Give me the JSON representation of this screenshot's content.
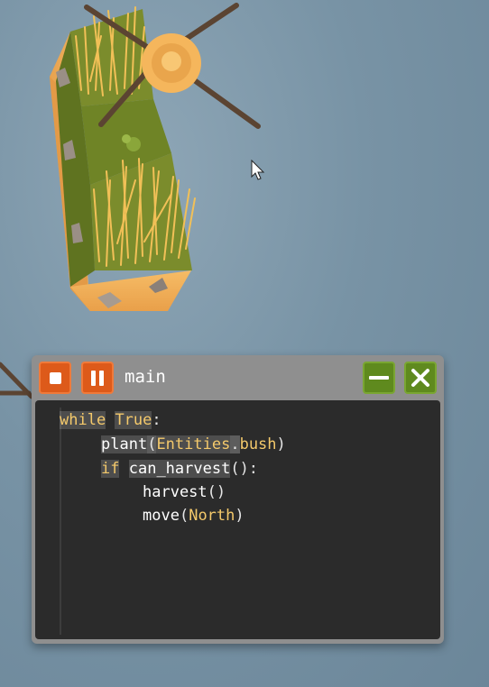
{
  "window": {
    "title": "main",
    "buttons": {
      "stop": "stop",
      "pause": "pause",
      "minimize": "minimize",
      "close": "close"
    }
  },
  "code": {
    "line1": {
      "kw": "while",
      "val": "True",
      "tail": ":"
    },
    "line2": {
      "fn": "plant",
      "open": "(",
      "ent": "Entities",
      "dot": ".",
      "attr": "bush",
      "close": ")"
    },
    "line3": {
      "kw": "if",
      "fn": "can_harvest",
      "tail": "():"
    },
    "line4": {
      "fn": "harvest",
      "tail": "()"
    },
    "line5": {
      "fn": "move",
      "open": "(",
      "ent": "North",
      "close": ")"
    }
  },
  "colors": {
    "keyword": "#f4c96b",
    "stop_button": "#dd5a1a",
    "window_button": "#5f8a1e",
    "editor_bg": "#2b2b2b",
    "sky": "#7893a5"
  },
  "icons": [
    "stop-icon",
    "pause-icon",
    "minimize-icon",
    "close-icon",
    "mouse-cursor-icon",
    "windmill-icon"
  ]
}
